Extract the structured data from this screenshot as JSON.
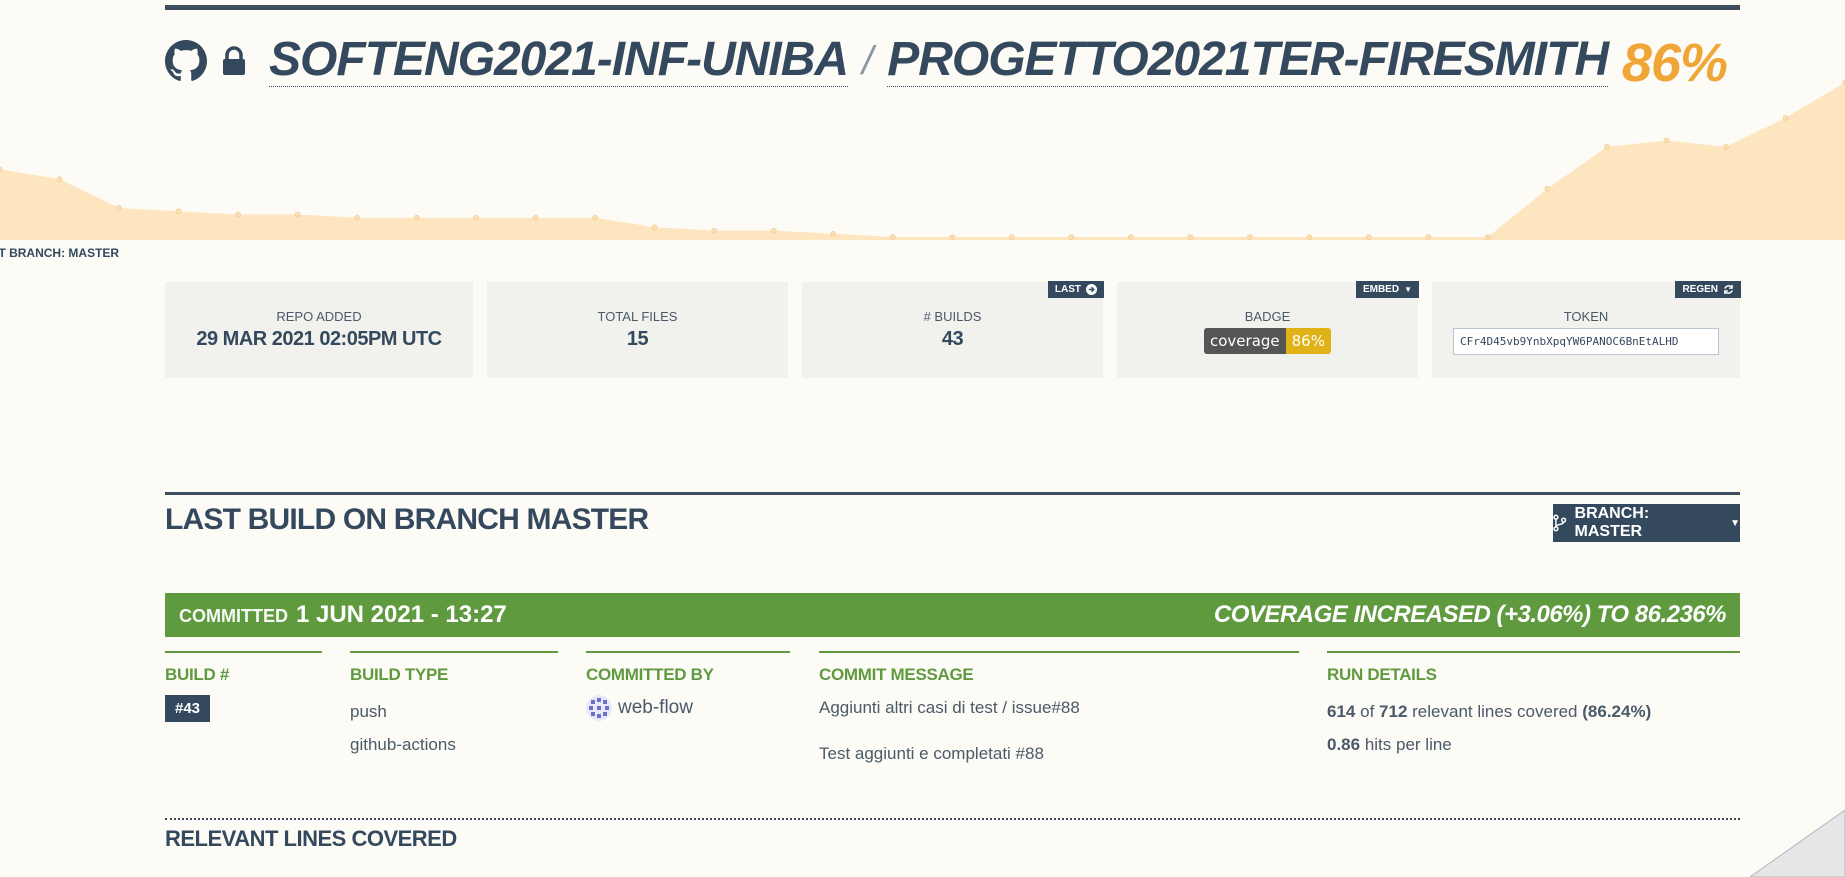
{
  "header": {
    "owner": "SOFTENG2021-INF-UNIBA",
    "separator": "/",
    "repo": "PROGETTO2021TER-FIRESMITH",
    "coverage": "86%",
    "default_branch": "LT BRANCH: MASTER"
  },
  "chart_data": {
    "type": "area",
    "x": [
      1,
      2,
      3,
      4,
      5,
      6,
      7,
      8,
      9,
      10,
      11,
      12,
      13,
      14,
      15,
      16,
      17,
      18,
      19,
      20,
      21,
      22,
      23,
      24,
      25,
      26,
      27,
      28,
      29,
      30,
      31,
      32
    ],
    "values": [
      84.2,
      83.9,
      83.0,
      82.9,
      82.8,
      82.8,
      82.7,
      82.7,
      82.7,
      82.7,
      82.7,
      82.4,
      82.3,
      82.3,
      82.2,
      82.1,
      82.1,
      82.1,
      82.1,
      82.1,
      82.1,
      82.1,
      82.1,
      82.1,
      82.1,
      82.1,
      83.6,
      84.9,
      85.1,
      84.9,
      85.8,
      86.9
    ],
    "colors": {
      "fill": "#fde5bf",
      "stroke": "#f5c98a",
      "dots": "#f8dfb6"
    }
  },
  "stats": {
    "repo_added": {
      "label": "REPO ADDED",
      "value": "29 MAR 2021 02:05PM UTC"
    },
    "total_files": {
      "label": "TOTAL FILES",
      "value": "15"
    },
    "builds": {
      "label": "# BUILDS",
      "value": "43",
      "button": "LAST"
    },
    "badge": {
      "label": "BADGE",
      "left": "coverage",
      "right": "86%",
      "button": "EMBED"
    },
    "token": {
      "label": "TOKEN",
      "value": "CFr4D45vb9YnbXpqYW6PANOC6BnEtALHD",
      "button": "REGEN"
    }
  },
  "last_build": {
    "title": "LAST BUILD ON BRANCH MASTER",
    "branch_button": "BRANCH: MASTER",
    "committed_label": "COMMITTED",
    "committed_date": "1 JUN 2021 - 13:27",
    "coverage_change": "COVERAGE INCREASED (+3.06%) TO 86.236%"
  },
  "columns": {
    "build": {
      "head": "BUILD #",
      "value": "#43"
    },
    "type": {
      "head": "BUILD TYPE",
      "lines": [
        "push",
        "github-actions"
      ]
    },
    "committer": {
      "head": "COMMITTED BY",
      "name": "web-flow"
    },
    "message": {
      "head": "COMMIT MESSAGE",
      "lines": [
        "Aggiunti altri casi di test / issue#88",
        "Test aggiunti e completati #88"
      ]
    },
    "run": {
      "head": "RUN DETAILS",
      "covered": "614",
      "of": "of",
      "relevant": "712",
      "relevant_text": "relevant lines covered",
      "pct": "(86.24%)",
      "hits": "0.86",
      "hits_text": "hits per line"
    }
  },
  "lines_section": {
    "title": "RELEVANT LINES COVERED"
  }
}
